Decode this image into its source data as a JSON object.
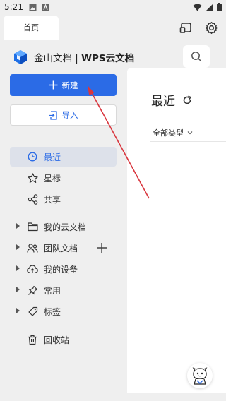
{
  "status_bar": {
    "time": "5:21"
  },
  "tabs": [
    {
      "label": "首页"
    }
  ],
  "brand": {
    "name_part1": "金山文档 | ",
    "name_part2": "WPS云文档"
  },
  "actions": {
    "new_label": "新建",
    "import_label": "导入"
  },
  "nav": {
    "recent": "最近",
    "starred": "星标",
    "shared": "共享",
    "my_cloud": "我的云文档",
    "team_docs": "团队文档",
    "my_devices": "我的设备",
    "frequent": "常用",
    "tags": "标签",
    "trash": "回收站"
  },
  "main": {
    "title": "最近",
    "filter_label": "全部类型"
  },
  "colors": {
    "accent": "#2b6be6",
    "annotation_arrow": "#d9363e"
  }
}
